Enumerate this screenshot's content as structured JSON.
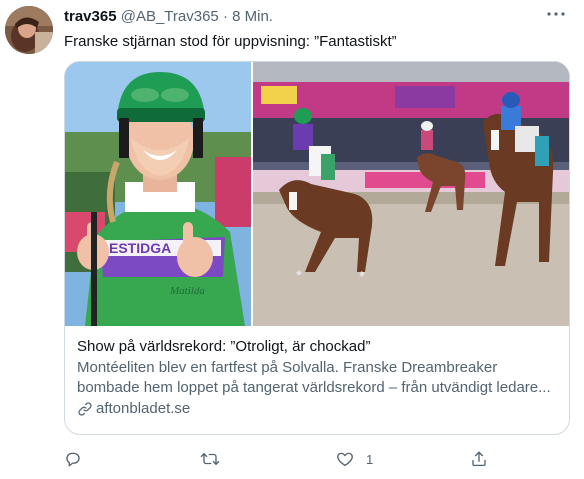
{
  "tweet": {
    "author_name": "trav365",
    "author_handle": "@AB_Trav365",
    "separator": "·",
    "time": "8 Min.",
    "text": "Franske stjärnan stod för uppvisning: ”Fantastiskt”"
  },
  "card": {
    "title": "Show på världsrekord: ”Otroligt, är chockad”",
    "description_line1": "Montéeliten blev en fartfest på Solvalla. Franske Dreambreaker",
    "description_line2": "bombade hem loppet på tangerat världsrekord – från utvändigt ledare...",
    "domain": "aftonbladet.se",
    "photo_banner_text": "ESTIDGA",
    "photo_glove_text": "Matilda"
  },
  "actions": {
    "reply_count": "",
    "retweet_count": "",
    "like_count": "1",
    "share_count": ""
  },
  "colors": {
    "text_primary": "#0f1419",
    "text_secondary": "#536471",
    "border": "#cfd9de"
  }
}
